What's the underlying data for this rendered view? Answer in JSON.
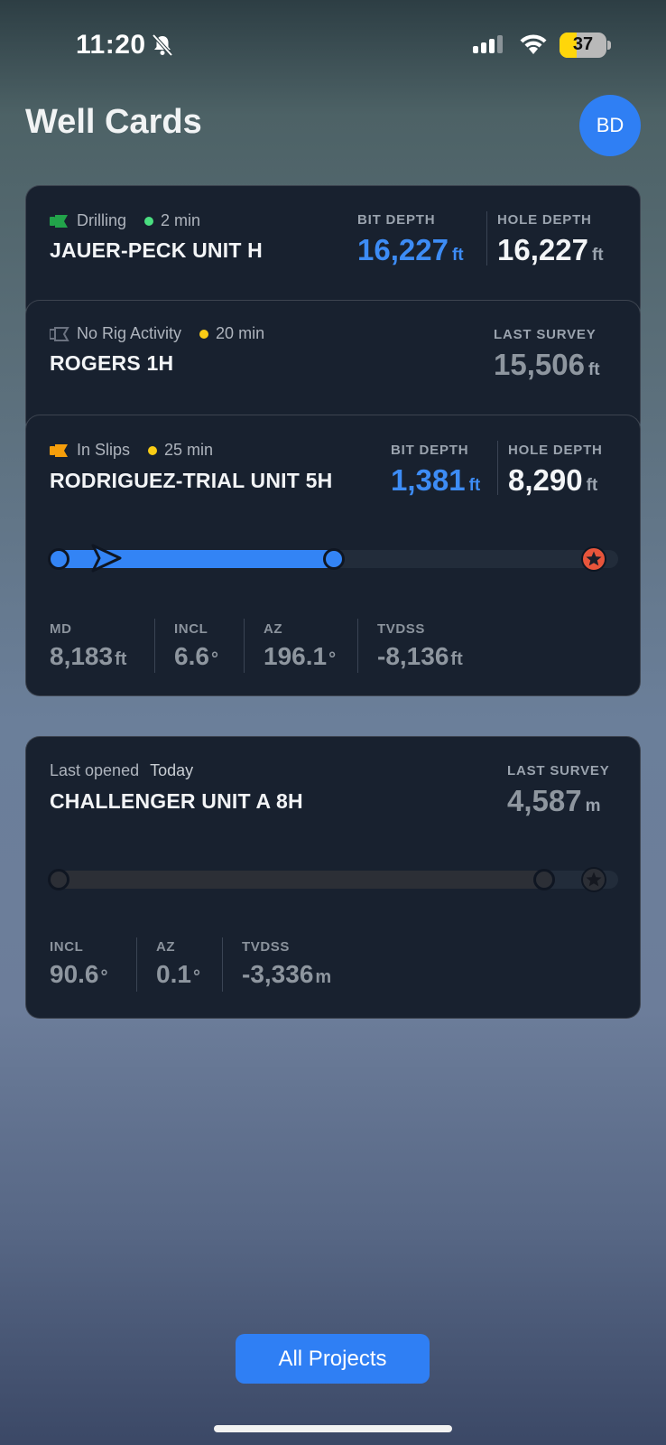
{
  "status_bar": {
    "time": "11:20",
    "battery": "37",
    "battery_level": 0.37
  },
  "header": {
    "title": "Well Cards",
    "avatar_initials": "BD"
  },
  "colors": {
    "accent": "#2f7ff4",
    "drilling": "#22c55e",
    "recent": "#facc15",
    "slips": "#f59e0b",
    "target": "#e8553b"
  },
  "cards": [
    {
      "status": "Drilling",
      "age": "2 min",
      "name": "JAUER-PECK UNIT H",
      "bit_depth_label": "BIT DEPTH",
      "bit_depth": "16,227",
      "hole_depth_label": "HOLE DEPTH",
      "hole_depth": "16,227",
      "unit": "ft"
    },
    {
      "status": "No Rig Activity",
      "age": "20 min",
      "name": "ROGERS 1H",
      "last_survey_label": "LAST SURVEY",
      "last_survey": "15,506",
      "unit": "ft"
    },
    {
      "status": "In Slips",
      "age": "25 min",
      "name": "RODRIGUEZ-TRIAL UNIT 5H",
      "bit_depth_label": "BIT DEPTH",
      "bit_depth": "1,381",
      "hole_depth_label": "HOLE DEPTH",
      "hole_depth": "8,290",
      "unit": "ft",
      "progress_fraction": 0.5,
      "stats": {
        "md_label": "MD",
        "md": "8,183",
        "md_unit": "ft",
        "incl_label": "INCL",
        "incl": "6.6",
        "incl_unit": "°",
        "az_label": "AZ",
        "az": "196.1",
        "az_unit": "°",
        "tvdss_label": "TVDSS",
        "tvdss": "-8,136",
        "tvdss_unit": "ft"
      }
    },
    {
      "last_opened_label": "Last opened",
      "last_opened": "Today",
      "name": "CHALLENGER UNIT A 8H",
      "last_survey_label": "LAST SURVEY",
      "last_survey": "4,587",
      "unit": "m",
      "progress_fraction": 0.87,
      "stats": {
        "incl_label": "INCL",
        "incl": "90.6",
        "incl_unit": "°",
        "az_label": "AZ",
        "az": "0.1",
        "az_unit": "°",
        "tvdss_label": "TVDSS",
        "tvdss": "-3,336",
        "tvdss_unit": "m"
      }
    }
  ],
  "footer": {
    "all_projects_label": "All Projects"
  }
}
